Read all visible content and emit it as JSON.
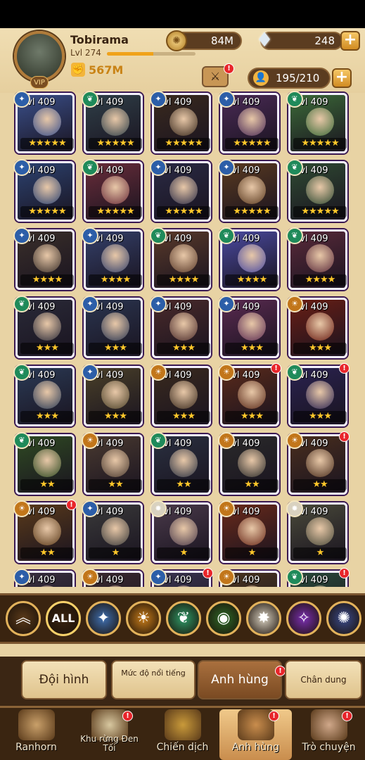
{
  "player": {
    "name": "Tobirama",
    "level_label": "Lvl 274",
    "xp_fraction": 0.52,
    "power": "567M"
  },
  "resources": {
    "gold": "84M",
    "gems": "248"
  },
  "hero_slots": "195/210",
  "heroes": [
    [
      {
        "lvl": "Lvl 409",
        "stars": "★★★★★",
        "faction": "Lightbearer",
        "color": "#3a4f8a",
        "badge": false
      },
      {
        "lvl": "Lvl 409",
        "stars": "★★★★★",
        "faction": "Wilder",
        "color": "#2f3f48",
        "badge": false
      },
      {
        "lvl": "Lvl 409",
        "stars": "★★★★★",
        "faction": "Lightbearer",
        "color": "#3a2a1e",
        "badge": false
      },
      {
        "lvl": "Lvl 409",
        "stars": "★★★★★",
        "faction": "Lightbearer",
        "color": "#4a2a55",
        "badge": false
      },
      {
        "lvl": "Lvl 409",
        "stars": "★★★★★",
        "faction": "Wilder",
        "color": "#3c6a38",
        "badge": false
      }
    ],
    [
      {
        "lvl": "Lvl 409",
        "stars": "★★★★★",
        "faction": "Lightbearer",
        "color": "#2c4270",
        "badge": false
      },
      {
        "lvl": "Lvl 409",
        "stars": "★★★★★",
        "faction": "Wilder",
        "color": "#6a2d3a",
        "badge": false
      },
      {
        "lvl": "Lvl 409",
        "stars": "★★★★★",
        "faction": "Lightbearer",
        "color": "#2a2a44",
        "badge": false
      },
      {
        "lvl": "Lvl 409",
        "stars": "★★★★★",
        "faction": "Lightbearer",
        "color": "#5a3a20",
        "badge": false
      },
      {
        "lvl": "Lvl 409",
        "stars": "★★★★★",
        "faction": "Wilder",
        "color": "#2f4a32",
        "badge": false
      }
    ],
    [
      {
        "lvl": "Lvl 409",
        "stars": "★★★★",
        "faction": "Lightbearer",
        "color": "#3a2f2a",
        "badge": false
      },
      {
        "lvl": "Lvl 409",
        "stars": "★★★★",
        "faction": "Lightbearer",
        "color": "#34406a",
        "badge": false
      },
      {
        "lvl": "Lvl 409",
        "stars": "★★★★",
        "faction": "Wilder",
        "color": "#5a3a2a",
        "badge": false
      },
      {
        "lvl": "Lvl 409",
        "stars": "★★★★",
        "faction": "Wilder",
        "color": "#4a4aa0",
        "badge": false
      },
      {
        "lvl": "Lvl 409",
        "stars": "★★★★",
        "faction": "Wilder",
        "color": "#5a2a3a",
        "badge": false
      }
    ],
    [
      {
        "lvl": "Lvl 409",
        "stars": "★★★",
        "faction": "Wilder",
        "color": "#2a2a38",
        "badge": false
      },
      {
        "lvl": "Lvl 409",
        "stars": "★★★",
        "faction": "Lightbearer",
        "color": "#2a3550",
        "badge": false
      },
      {
        "lvl": "Lvl 409",
        "stars": "★★★",
        "faction": "Lightbearer",
        "color": "#4a2a2a",
        "badge": false
      },
      {
        "lvl": "Lvl 409",
        "stars": "★★★",
        "faction": "Lightbearer",
        "color": "#5a2a50",
        "badge": false
      },
      {
        "lvl": "Lvl 409",
        "stars": "★★★",
        "faction": "Mauler",
        "color": "#6a1e14",
        "badge": false
      }
    ],
    [
      {
        "lvl": "Lvl 409",
        "stars": "★★★",
        "faction": "Wilder",
        "color": "#2a3a55",
        "badge": false
      },
      {
        "lvl": "Lvl 409",
        "stars": "★★★",
        "faction": "Lightbearer",
        "color": "#4a4028",
        "badge": false
      },
      {
        "lvl": "Lvl 409",
        "stars": "★★★",
        "faction": "Mauler",
        "color": "#3a2a1e",
        "badge": false
      },
      {
        "lvl": "Lvl 409",
        "stars": "★★★",
        "faction": "Mauler",
        "color": "#5a2a1a",
        "badge": true
      },
      {
        "lvl": "Lvl 409",
        "stars": "★★★",
        "faction": "Wilder",
        "color": "#2a2250",
        "badge": true
      }
    ],
    [
      {
        "lvl": "Lvl 409",
        "stars": "★★",
        "faction": "Wilder",
        "color": "#2f4a22",
        "badge": false
      },
      {
        "lvl": "Lvl 409",
        "stars": "★★",
        "faction": "Mauler",
        "color": "#4a3a30",
        "badge": false
      },
      {
        "lvl": "Lvl 409",
        "stars": "★★",
        "faction": "Wilder",
        "color": "#2a3040",
        "badge": false
      },
      {
        "lvl": "Lvl 409",
        "stars": "★★",
        "faction": "Mauler",
        "color": "#2a2a2a",
        "badge": false
      },
      {
        "lvl": "Lvl 409",
        "stars": "★★",
        "faction": "Mauler",
        "color": "#4a2e1e",
        "badge": true
      }
    ],
    [
      {
        "lvl": "Lvl 409",
        "stars": "★★",
        "faction": "Mauler",
        "color": "#5a3a1a",
        "badge": true
      },
      {
        "lvl": "Lvl 409",
        "stars": "★",
        "faction": "Lightbearer",
        "color": "#3a3a3a",
        "badge": false
      },
      {
        "lvl": "Lvl 409",
        "stars": "★",
        "faction": "Celestial",
        "color": "#4a3a4a",
        "badge": false
      },
      {
        "lvl": "Lvl 409",
        "stars": "★",
        "faction": "Mauler",
        "color": "#6a2a1a",
        "badge": false
      },
      {
        "lvl": "Lvl 409",
        "stars": "★",
        "faction": "Celestial",
        "color": "#4a4a3a",
        "badge": false
      }
    ],
    [
      {
        "lvl": "Lvl 409",
        "stars": "",
        "faction": "Lightbearer",
        "color": "#3a3040",
        "badge": false
      },
      {
        "lvl": "Lvl 409",
        "stars": "",
        "faction": "Mauler",
        "color": "#3a2a30",
        "badge": false
      },
      {
        "lvl": "Lvl 409",
        "stars": "",
        "faction": "Lightbearer",
        "color": "#3a3550",
        "badge": true
      },
      {
        "lvl": "Lvl 409",
        "stars": "",
        "faction": "Mauler",
        "color": "#4a3520",
        "badge": false
      },
      {
        "lvl": "Lvl 409",
        "stars": "",
        "faction": "Wilder",
        "color": "#2a4a3a",
        "badge": true
      }
    ]
  ],
  "faction_filters": [
    {
      "name": "collapse",
      "label": "︽",
      "color": "#5a3a1a"
    },
    {
      "name": "all",
      "label": "ALL",
      "color": "#3a2410"
    },
    {
      "name": "lightbearer",
      "label": "✦",
      "color": "#3f6fb0"
    },
    {
      "name": "mauler",
      "label": "☀",
      "color": "#c97d1a"
    },
    {
      "name": "wilder",
      "label": "❦",
      "color": "#2f9a68"
    },
    {
      "name": "graveborn",
      "label": "◉",
      "color": "#2f6a2a"
    },
    {
      "name": "celestial",
      "label": "✸",
      "color": "#d8d0c0"
    },
    {
      "name": "hypogean",
      "label": "✧",
      "color": "#7a2fb0"
    },
    {
      "name": "dimensional",
      "label": "✺",
      "color": "#3a4a8a"
    }
  ],
  "menu_tabs": [
    {
      "label": "Đội hình",
      "active": false
    },
    {
      "label": "Mức độ nổi tiếng",
      "active": false
    },
    {
      "label": "Anh hùng",
      "active": true
    },
    {
      "label": "Chân dung",
      "active": false
    }
  ],
  "nav": [
    {
      "label": "Ranhorn",
      "icon": "castle-icon",
      "badge": false,
      "active": false
    },
    {
      "label": "Khu rừng Đen Tối",
      "icon": "forest-map-icon",
      "badge": true,
      "active": false
    },
    {
      "label": "Chiến dịch",
      "icon": "campaign-icon",
      "badge": false,
      "active": false
    },
    {
      "label": "Anh hùng",
      "icon": "heroes-icon",
      "badge": true,
      "active": true
    },
    {
      "label": "Trò chuyện",
      "icon": "chat-icon",
      "badge": true,
      "active": false
    }
  ]
}
